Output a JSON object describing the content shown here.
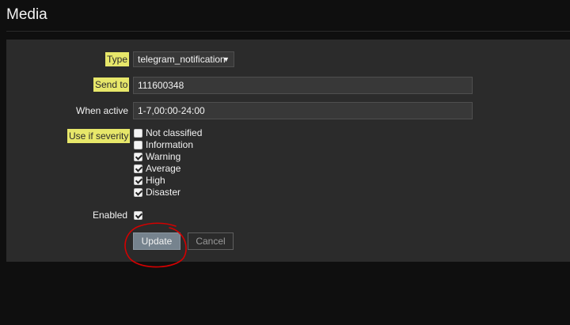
{
  "page": {
    "title": "Media"
  },
  "form": {
    "type_label": "Type",
    "type_value": "telegram_notification",
    "send_to_label": "Send to",
    "send_to_value": "111600348",
    "when_active_label": "When active",
    "when_active_value": "1-7,00:00-24:00",
    "severity_label": "Use if severity",
    "severities": [
      {
        "label": "Not classified",
        "checked": false
      },
      {
        "label": "Information",
        "checked": false
      },
      {
        "label": "Warning",
        "checked": true
      },
      {
        "label": "Average",
        "checked": true
      },
      {
        "label": "High",
        "checked": true
      },
      {
        "label": "Disaster",
        "checked": true
      }
    ],
    "enabled_label": "Enabled",
    "enabled_checked": true
  },
  "buttons": {
    "update_label": "Update",
    "cancel_label": "Cancel"
  },
  "colors": {
    "highlight": "#e7e76a",
    "annotation": "#d40000",
    "panel": "#2b2b2b",
    "background": "#0f0f0f"
  }
}
